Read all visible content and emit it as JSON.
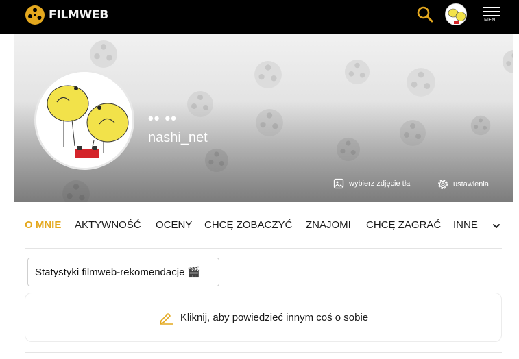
{
  "header": {
    "brand": "FILMWEB",
    "menu_label": "MENU",
    "accent_color": "#e4a81e"
  },
  "icons": {
    "logo": "film-reel-logo-icon",
    "search": "search-icon",
    "menu": "hamburger-menu-icon",
    "image": "image-icon",
    "settings": "gear-icon",
    "chevron": "chevron-down-icon",
    "edit": "pencil-edit-icon"
  },
  "profile": {
    "display_name": "•• ••",
    "username": "nashi_net",
    "choose_background_label": "wybierz zdjęcie tła",
    "settings_label": "ustawienia"
  },
  "tabs": [
    {
      "label": "O MNIE",
      "active": true
    },
    {
      "label": "AKTYWNOŚĆ",
      "active": false
    },
    {
      "label": "OCENY",
      "active": false
    },
    {
      "label": "CHCĘ ZOBACZYĆ",
      "active": false
    },
    {
      "label": "ZNAJOMI",
      "active": false
    },
    {
      "label": "CHCĘ ZAGRAĆ",
      "active": false
    },
    {
      "label": "INNE",
      "active": false
    }
  ],
  "content": {
    "stats_button_label": "Statystyki filmweb-rekomendacje",
    "stats_button_emoji": "🎬",
    "about_prompt": "Kliknij, aby powiedzieć innym coś o sobie"
  }
}
